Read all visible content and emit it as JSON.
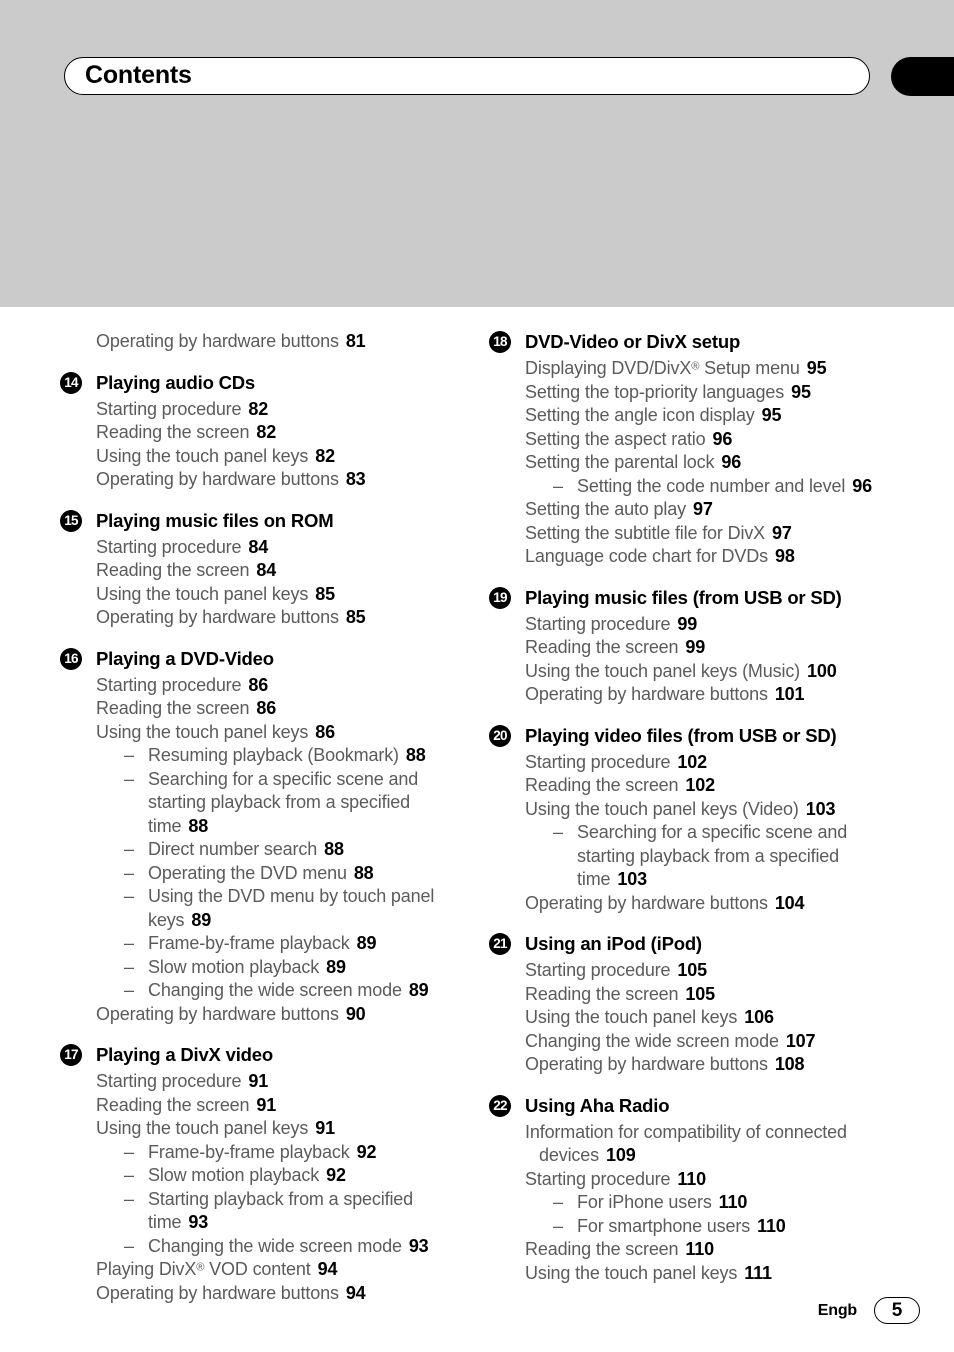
{
  "header": {
    "title": "Contents"
  },
  "footer": {
    "language": "Engb",
    "page_number": "5"
  },
  "columns": {
    "left": {
      "orphan_entries": [
        {
          "label": "Operating by hardware buttons",
          "page": "81"
        }
      ],
      "sections": [
        {
          "number": "14",
          "title": "Playing audio CDs",
          "entries": [
            {
              "level": 1,
              "label": "Starting procedure",
              "page": "82"
            },
            {
              "level": 1,
              "label": "Reading the screen",
              "page": "82"
            },
            {
              "level": 1,
              "label": "Using the touch panel keys",
              "page": "82"
            },
            {
              "level": 1,
              "label": "Operating by hardware buttons",
              "page": "83"
            }
          ]
        },
        {
          "number": "15",
          "title": "Playing music files on ROM",
          "entries": [
            {
              "level": 1,
              "label": "Starting procedure",
              "page": "84"
            },
            {
              "level": 1,
              "label": "Reading the screen",
              "page": "84"
            },
            {
              "level": 1,
              "label": "Using the touch panel keys",
              "page": "85"
            },
            {
              "level": 1,
              "label": "Operating by hardware buttons",
              "page": "85"
            }
          ]
        },
        {
          "number": "16",
          "title": "Playing a DVD-Video",
          "entries": [
            {
              "level": 1,
              "label": "Starting procedure",
              "page": "86"
            },
            {
              "level": 1,
              "label": "Reading the screen",
              "page": "86"
            },
            {
              "level": 1,
              "label": "Using the touch panel keys",
              "page": "86"
            },
            {
              "level": 2,
              "label": "Resuming playback (Bookmark)",
              "page": "88"
            },
            {
              "level": 2,
              "label": "Searching for a specific scene and starting playback from a specified time",
              "page": "88"
            },
            {
              "level": 2,
              "label": "Direct number search",
              "page": "88"
            },
            {
              "level": 2,
              "label": "Operating the DVD menu",
              "page": "88"
            },
            {
              "level": 2,
              "label": "Using the DVD menu by touch panel keys",
              "page": "89"
            },
            {
              "level": 2,
              "label": "Frame-by-frame playback",
              "page": "89"
            },
            {
              "level": 2,
              "label": "Slow motion playback",
              "page": "89"
            },
            {
              "level": 2,
              "label": "Changing the wide screen mode",
              "page": "89"
            },
            {
              "level": 1,
              "label": "Operating by hardware buttons",
              "page": "90"
            }
          ]
        },
        {
          "number": "17",
          "title": "Playing a DivX video",
          "entries": [
            {
              "level": 1,
              "label": "Starting procedure",
              "page": "91"
            },
            {
              "level": 1,
              "label": "Reading the screen",
              "page": "91"
            },
            {
              "level": 1,
              "label": "Using the touch panel keys",
              "page": "91"
            },
            {
              "level": 2,
              "label": "Frame-by-frame playback",
              "page": "92"
            },
            {
              "level": 2,
              "label": "Slow motion playback",
              "page": "92"
            },
            {
              "level": 2,
              "label": "Starting playback from a specified time",
              "page": "93"
            },
            {
              "level": 2,
              "label": "Changing the wide screen mode",
              "page": "93"
            },
            {
              "level": 1,
              "label": "Playing DivX® VOD content",
              "page": "94",
              "reg_after": "DivX"
            },
            {
              "level": 1,
              "label": "Operating by hardware buttons",
              "page": "94"
            }
          ]
        }
      ]
    },
    "right": {
      "orphan_entries": [],
      "sections": [
        {
          "number": "18",
          "title": "DVD-Video or DivX setup",
          "entries": [
            {
              "level": 1,
              "label": "Displaying DVD/DivX® Setup menu",
              "page": "95"
            },
            {
              "level": 1,
              "label": "Setting the top-priority languages",
              "page": "95"
            },
            {
              "level": 1,
              "label": "Setting the angle icon display",
              "page": "95"
            },
            {
              "level": 1,
              "label": "Setting the aspect ratio",
              "page": "96"
            },
            {
              "level": 1,
              "label": "Setting the parental lock",
              "page": "96"
            },
            {
              "level": 2,
              "label": "Setting the code number and level",
              "page": "96"
            },
            {
              "level": 1,
              "label": "Setting the auto play",
              "page": "97"
            },
            {
              "level": 1,
              "label": "Setting the subtitle file for DivX",
              "page": "97"
            },
            {
              "level": 1,
              "label": "Language code chart for DVDs",
              "page": "98"
            }
          ]
        },
        {
          "number": "19",
          "title": "Playing music files (from USB or SD)",
          "entries": [
            {
              "level": 1,
              "label": "Starting procedure",
              "page": "99"
            },
            {
              "level": 1,
              "label": "Reading the screen",
              "page": "99"
            },
            {
              "level": 1,
              "label": "Using the touch panel keys (Music)",
              "page": "100"
            },
            {
              "level": 1,
              "label": "Operating by hardware buttons",
              "page": "101"
            }
          ]
        },
        {
          "number": "20",
          "title": "Playing video files (from USB or SD)",
          "entries": [
            {
              "level": 1,
              "label": "Starting procedure",
              "page": "102"
            },
            {
              "level": 1,
              "label": "Reading the screen",
              "page": "102"
            },
            {
              "level": 1,
              "label": "Using the touch panel keys (Video)",
              "page": "103"
            },
            {
              "level": 2,
              "label": "Searching for a specific scene and starting playback from a specified time",
              "page": "103"
            },
            {
              "level": 1,
              "label": "Operating by hardware buttons",
              "page": "104"
            }
          ]
        },
        {
          "number": "21",
          "title": "Using an iPod (iPod)",
          "entries": [
            {
              "level": 1,
              "label": "Starting procedure",
              "page": "105"
            },
            {
              "level": 1,
              "label": "Reading the screen",
              "page": "105"
            },
            {
              "level": 1,
              "label": "Using the touch panel keys",
              "page": "106"
            },
            {
              "level": 1,
              "label": "Changing the wide screen mode",
              "page": "107"
            },
            {
              "level": 1,
              "label": "Operating by hardware buttons",
              "page": "108"
            }
          ]
        },
        {
          "number": "22",
          "title": "Using Aha Radio",
          "entries": [
            {
              "level": 1,
              "label": "Information for compatibility of connected devices",
              "page": "109"
            },
            {
              "level": 1,
              "label": "Starting procedure",
              "page": "110"
            },
            {
              "level": 2,
              "label": "For iPhone users",
              "page": "110"
            },
            {
              "level": 2,
              "label": "For smartphone users",
              "page": "110"
            },
            {
              "level": 1,
              "label": "Reading the screen",
              "page": "110"
            },
            {
              "level": 1,
              "label": "Using the touch panel keys",
              "page": "111"
            }
          ]
        }
      ]
    }
  }
}
